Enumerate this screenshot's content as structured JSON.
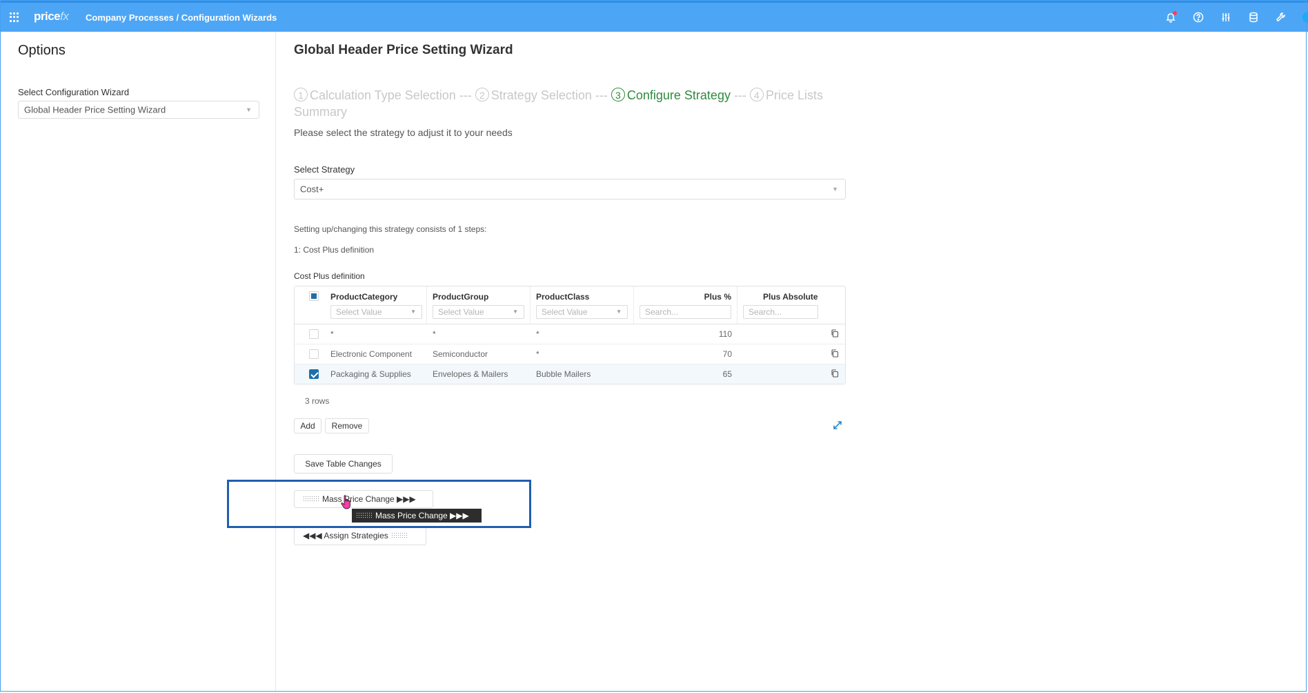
{
  "topbar": {
    "logo_main": "price",
    "logo_accent": "fx",
    "breadcrumb": "Company Processes / Configuration Wizards",
    "icons": [
      "bell-icon",
      "help-icon",
      "sliders-icon",
      "database-icon",
      "tools-icon"
    ]
  },
  "left": {
    "title": "Options",
    "select_label": "Select Configuration Wizard",
    "select_value": "Global Header Price Setting Wizard"
  },
  "main": {
    "title": "Global Header Price Setting Wizard",
    "steps": [
      {
        "num": "1",
        "label": "Calculation Type Selection",
        "sep": " --- "
      },
      {
        "num": "2",
        "label": "Strategy Selection",
        "sep": " --- "
      },
      {
        "num": "3",
        "label": "Configure Strategy",
        "sep": " --- "
      },
      {
        "num": "4",
        "label": "Price Lists Summary",
        "sep": ""
      }
    ],
    "active_step": 3,
    "hint": "Please select the strategy to adjust it to your needs",
    "strategy_label": "Select Strategy",
    "strategy_value": "Cost+",
    "steps_info": "Setting up/changing this strategy consists of 1 steps:",
    "step_def": "1: Cost Plus definition",
    "table_label": "Cost Plus definition"
  },
  "table": {
    "columns": [
      "ProductCategory",
      "ProductGroup",
      "ProductClass",
      "Plus %",
      "Plus Absolute"
    ],
    "filter_placeholders": [
      "Select Value",
      "Select Value",
      "Select Value",
      "Search...",
      "Search..."
    ],
    "rows": [
      {
        "category": "*",
        "group": "*",
        "class": "*",
        "plus_pct": "110",
        "plus_abs": "",
        "checked": false
      },
      {
        "category": "Electronic Component",
        "group": "Semiconductor",
        "class": "*",
        "plus_pct": "70",
        "plus_abs": "",
        "checked": false
      },
      {
        "category": "Packaging & Supplies",
        "group": "Envelopes & Mailers",
        "class": "Bubble Mailers",
        "plus_pct": "65",
        "plus_abs": "",
        "checked": true
      }
    ],
    "row_count": "3 rows"
  },
  "buttons": {
    "add": "Add",
    "remove": "Remove",
    "save": "Save Table Changes",
    "mass_price": "Mass Price Change ▶▶▶",
    "assign": "◀◀◀ Assign Strategies"
  },
  "tooltip": "Mass Price Change ▶▶▶",
  "colors": {
    "topbar": "#4da6f5",
    "active_step": "#2e8b3e",
    "highlight": "#1f5eb0",
    "checkbox": "#1e6fa8"
  }
}
